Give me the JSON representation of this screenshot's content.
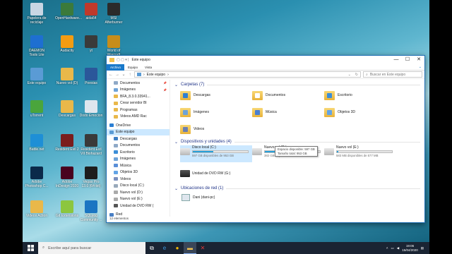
{
  "desktop": {
    "icons": [
      {
        "label": "Papelera de reciclaje",
        "icon": "recycle-bin-icon",
        "color": "#c9d6e3"
      },
      {
        "label": "OpenHardware...",
        "icon": "hardware-monitor-icon",
        "color": "#3b7a3b"
      },
      {
        "label": "aida64",
        "icon": "aida64-icon",
        "color": "#c0392b"
      },
      {
        "label": "MSI Afterburner",
        "icon": "msi-afterburner-icon",
        "color": "#2b2b2b"
      },
      {
        "label": "DAEMON Tools Lite",
        "icon": "daemon-tools-icon",
        "color": "#1e6fd1"
      },
      {
        "label": "Audacity",
        "icon": "audacity-icon",
        "color": "#f39c12"
      },
      {
        "label": "yt",
        "icon": "yt-icon",
        "color": "#3a3a3a"
      },
      {
        "label": "World of Warcraft",
        "icon": "world-of-warcraft-icon",
        "color": "#c78d1a"
      },
      {
        "label": "Este equipo",
        "icon": "this-pc-icon",
        "color": "#5a9bd5"
      },
      {
        "label": "Nuevo vol (D)",
        "icon": "folder-icon",
        "color": "#e9b84a"
      },
      {
        "label": "Poesias",
        "icon": "word-document-icon",
        "color": "#2b579a"
      },
      {
        "label": "uTorrent",
        "icon": "utorrent-icon",
        "color": "#4aa53c"
      },
      {
        "label": "Descargas",
        "icon": "folder-icon",
        "color": "#e9b84a"
      },
      {
        "label": "Dodo Emocion",
        "icon": "document-icon",
        "color": "#dfe6ee"
      },
      {
        "label": "Battle.net",
        "icon": "battlenet-icon",
        "color": "#1e8fd6"
      },
      {
        "label": "Resident Evil 2",
        "icon": "resident-evil-icon",
        "color": "#7a1d1d"
      },
      {
        "label": "Resident Evil VII Biohazard",
        "icon": "resident-evil-7-icon",
        "color": "#3a3a3a"
      },
      {
        "label": "Adobe Photoshop C...",
        "icon": "photoshop-icon",
        "color": "#0b2a4a"
      },
      {
        "label": "Adobe InDesign 2020",
        "icon": "indesign-icon",
        "color": "#49021f"
      },
      {
        "label": "Vegas Pro 13.0 (64-bit)",
        "icon": "vegas-pro-icon",
        "color": "#1d1d1d"
      },
      {
        "label": "Videos Action",
        "icon": "videos-folder-icon",
        "color": "#e9b84a"
      },
      {
        "label": "Git Extensions",
        "icon": "git-extensions-icon",
        "color": "#8cc63f"
      },
      {
        "label": "SQLyog Community ...",
        "icon": "sqlyog-icon",
        "color": "#1a75c2"
      }
    ]
  },
  "window": {
    "title": "Este equipo",
    "controls": {
      "minimize": "—",
      "maximize": "☐",
      "close": "✕"
    },
    "ribbon_tabs": [
      "Archivo",
      "Equipo",
      "Vista"
    ],
    "address": {
      "path": "Este equipo",
      "sep": "›"
    },
    "search_placeholder": "Buscar en Este equipo",
    "sidebar": [
      {
        "label": "Documentos",
        "pin": "📌",
        "color": "#8fa9c7"
      },
      {
        "label": "Imágenes",
        "pin": "📌",
        "color": "#6ea3d8"
      },
      {
        "label": "BFA_8.3.0.33941...",
        "pin": "",
        "color": "#e9b84a"
      },
      {
        "label": "Crear servidor Bl",
        "pin": "",
        "color": "#e9b84a"
      },
      {
        "label": "Programas",
        "pin": "",
        "color": "#e9b84a"
      },
      {
        "label": "Videos AMD Rac",
        "pin": "",
        "color": "#e9b84a"
      },
      {
        "label": "OneDrive",
        "pin": "",
        "color": "#2a7fd4"
      },
      {
        "label": "Este equipo",
        "pin": "",
        "color": "#5a9bd5",
        "selected": true
      },
      {
        "label": "Descargas",
        "pin": "",
        "color": "#3d7fc4"
      },
      {
        "label": "Documentos",
        "pin": "",
        "color": "#8fa9c7"
      },
      {
        "label": "Escritorio",
        "pin": "",
        "color": "#3c8ed8"
      },
      {
        "label": "Imágenes",
        "pin": "",
        "color": "#6ea3d8"
      },
      {
        "label": "Música",
        "pin": "",
        "color": "#5a8fd8"
      },
      {
        "label": "Objetos 3D",
        "pin": "",
        "color": "#63a4e6"
      },
      {
        "label": "Videos",
        "pin": "",
        "color": "#7a8fbe"
      },
      {
        "label": "Disco local (C:)",
        "pin": "",
        "color": "#9ab"
      },
      {
        "label": "Nuevo vol (D:)",
        "pin": "",
        "color": "#aaa"
      },
      {
        "label": "Nuevo vol (E:)",
        "pin": "",
        "color": "#aaa"
      },
      {
        "label": "Unidad de DVD RW (",
        "pin": "",
        "color": "#555"
      },
      {
        "label": "Red",
        "pin": "",
        "color": "#4a7fc4"
      }
    ],
    "folders_section": {
      "title": "Carpetas (7)",
      "items": [
        {
          "label": "Descargas",
          "icon": "downloads-folder-icon",
          "accent": "#2f7fd0"
        },
        {
          "label": "Documentos",
          "icon": "documents-folder-icon",
          "accent": "#ffffff"
        },
        {
          "label": "Escritorio",
          "icon": "desktop-folder-icon",
          "accent": "#3c8ed8"
        },
        {
          "label": "Imágenes",
          "icon": "pictures-folder-icon",
          "accent": "#6ea3d8"
        },
        {
          "label": "Música",
          "icon": "music-folder-icon",
          "accent": "#4a7fd0"
        },
        {
          "label": "Objetos 3D",
          "icon": "3d-objects-folder-icon",
          "accent": "#63a4e6"
        },
        {
          "label": "Videos",
          "icon": "videos-folder-icon",
          "accent": "#6b7fb0"
        }
      ]
    },
    "drives_section": {
      "title": "Dispositivos y unidades (4)",
      "items": [
        {
          "label": "Disco local (C:)",
          "free": "597 GB disponibles de 953 GB",
          "fill": 0.37,
          "selected": true,
          "icon": "windows-drive-icon"
        },
        {
          "label": "Nuevo vol (D:)",
          "free": "382 GB disponibles de 465 GB",
          "fill": 0.18,
          "selected": false,
          "icon": "hard-drive-icon"
        },
        {
          "label": "Nuevo vol (E:)",
          "free": "583 MB disponibles de 577 MB",
          "fill": 0.02,
          "selected": false,
          "icon": "hard-drive-icon"
        },
        {
          "label": "Unidad de DVD RW (G:)",
          "free": "",
          "fill": null,
          "selected": false,
          "icon": "dvd-drive-icon"
        }
      ]
    },
    "tooltip": {
      "line1": "Espacio disponible: 597 GB",
      "line2": "Tamaño total: 953 GB"
    },
    "network_section": {
      "title": "Ubicaciones de red (1)",
      "items": [
        {
          "label": "Dani (dani-pc)",
          "icon": "network-pc-icon"
        }
      ]
    },
    "status": "12 elementos"
  },
  "taskbar": {
    "search_placeholder": "Escribe aquí para buscar",
    "apps": [
      {
        "name": "task-view-icon",
        "glyph": "⧉",
        "color": "#ffffff",
        "active": false
      },
      {
        "name": "edge-icon",
        "glyph": "e",
        "color": "#3a96dd",
        "active": false
      },
      {
        "name": "chrome-icon",
        "glyph": "●",
        "color": "#f2b705",
        "active": false
      },
      {
        "name": "file-explorer-icon",
        "glyph": "▬",
        "color": "#f2c14e",
        "active": true
      },
      {
        "name": "aida64-taskbar-icon",
        "glyph": "✕",
        "color": "#e03a3a",
        "active": false
      }
    ],
    "time": "19:06",
    "date": "15/04/2020"
  }
}
